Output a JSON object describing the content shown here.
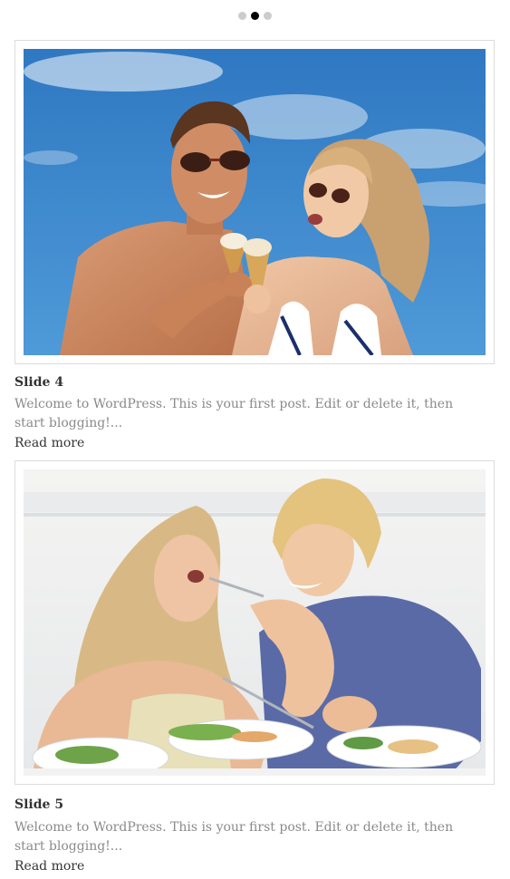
{
  "pagination": {
    "dots": [
      "slide-1",
      "slide-2",
      "slide-3"
    ],
    "active_index": 1
  },
  "slides": [
    {
      "title": "Slide 4",
      "excerpt": "Welcome to WordPress. This is your first post. Edit or delete it, then start blogging!...",
      "read_more": "Read more",
      "image_alt": "couple-with-ice-cream-photo"
    },
    {
      "title": "Slide 5",
      "excerpt": "Welcome to WordPress. This is your first post. Edit or delete it, then start blogging!...",
      "read_more": "Read more",
      "image_alt": "couple-eating-salad-photo"
    }
  ],
  "colors": {
    "dot_inactive": "#cccccc",
    "dot_active": "#000000",
    "frame_border": "#dcdcdc",
    "title_text": "#333333",
    "excerpt_text": "#8a8a8a",
    "sky_blue": "#3a83c9"
  }
}
